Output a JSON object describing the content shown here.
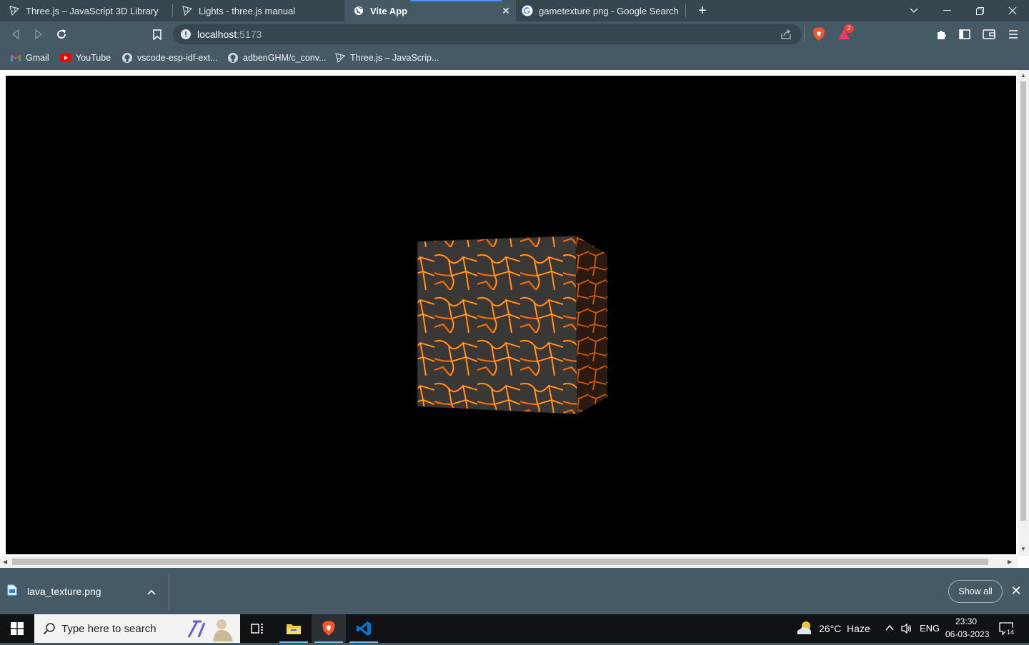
{
  "tabs": [
    {
      "title": "Three.js – JavaScript 3D Library",
      "icon": "threejs-icon",
      "active": false
    },
    {
      "title": "Lights - three.js manual",
      "icon": "threejs-icon",
      "active": false
    },
    {
      "title": "Vite App",
      "icon": "globe-icon",
      "active": true
    },
    {
      "title": "gametexture png - Google Search",
      "icon": "google-icon",
      "active": false
    }
  ],
  "address_bar": {
    "host": "localhost",
    "port": ":5173"
  },
  "bookmarks": [
    {
      "label": "Gmail",
      "icon": "gmail-icon"
    },
    {
      "label": "YouTube",
      "icon": "youtube-icon"
    },
    {
      "label": "vscode-esp-idf-ext...",
      "icon": "github-icon"
    },
    {
      "label": "adbenGHM/c_conv...",
      "icon": "github-icon"
    },
    {
      "label": "Three.js – JavaScrip...",
      "icon": "threejs-icon"
    }
  ],
  "brave_rewards_badge": "2",
  "viewport": {
    "scene": "lava textured cube on black background"
  },
  "downloads": {
    "file_name": "lava_texture.png",
    "show_all_label": "Show all"
  },
  "taskbar": {
    "search_placeholder": "Type here to search",
    "weather": "26°C  Haze",
    "language": "ENG",
    "time": "23:30",
    "date": "06-03-2023",
    "notifications": "14"
  },
  "colors": {
    "tab_bar": "#37474f",
    "toolbar": "#455a64",
    "accent": "#4d8ef7",
    "lava": "#ff6a00"
  }
}
